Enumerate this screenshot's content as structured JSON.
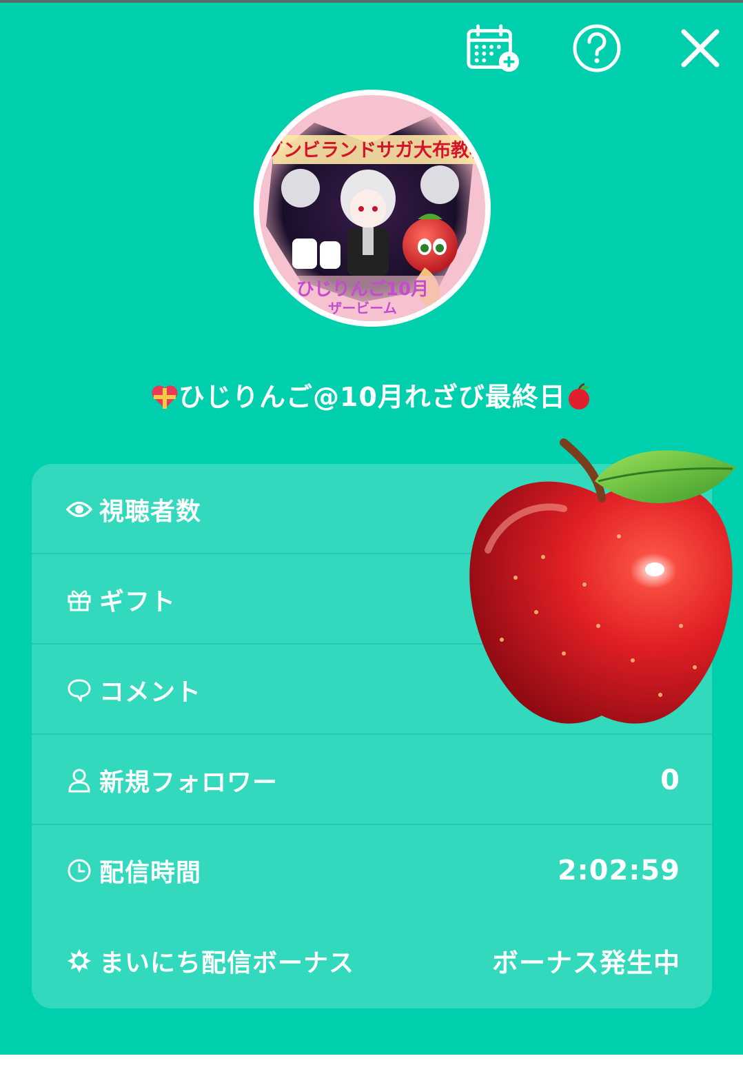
{
  "header": {
    "icons": {
      "calendar": "calendar-add-icon",
      "help": "help-icon",
      "close": "close-icon"
    }
  },
  "profile": {
    "avatar_text_top": "ゾンビランドサガ大布教枠",
    "avatar_text_bottom": "ひじりんご10月",
    "avatar_text_bottom2": "ザービーム",
    "username": "ひじりんご@10月れざび最終日",
    "username_prefix_icon": "heart-gift-icon",
    "username_suffix_icon": "apple-icon"
  },
  "stats": {
    "rows": [
      {
        "label": "視聴者数",
        "icon": "eye-icon",
        "value": ""
      },
      {
        "label": "ギフト",
        "icon": "gift-icon",
        "value": ""
      },
      {
        "label": "コメント",
        "icon": "comment-icon",
        "value": ""
      },
      {
        "label": "新規フォロワー",
        "icon": "user-icon",
        "value": "0"
      },
      {
        "label": "配信時間",
        "icon": "clock-icon",
        "value": "2:02:59"
      },
      {
        "label": "まいにち配信ボーナス",
        "icon": "sun-icon",
        "value": "ボーナス発生中"
      }
    ]
  },
  "colors": {
    "background": "#00cfae",
    "card": "#32d9bc",
    "text": "#ffffff"
  }
}
